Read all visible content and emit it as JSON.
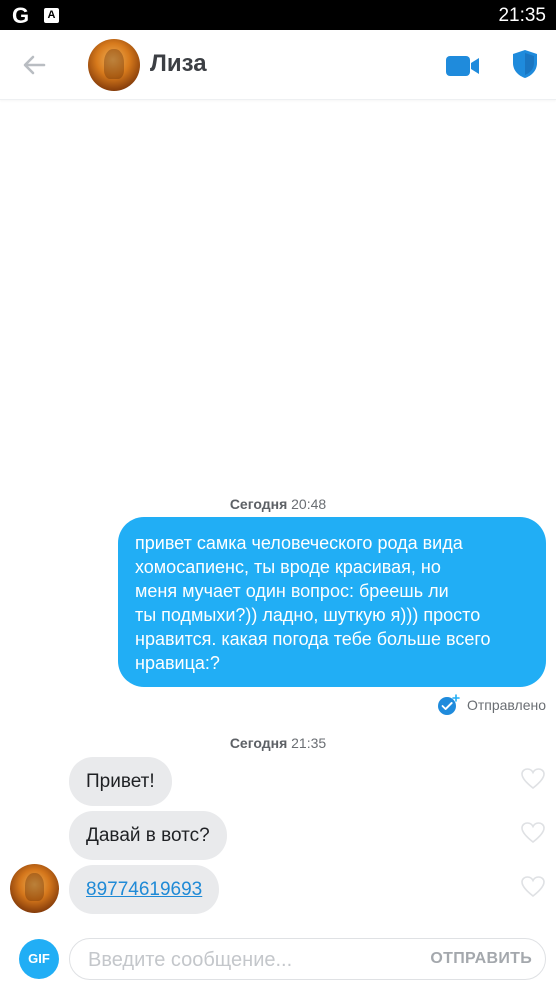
{
  "status_bar": {
    "time": "21:35",
    "icons": [
      "google-icon",
      "a-icon"
    ]
  },
  "header": {
    "contact_name": "Лиза",
    "icons": {
      "back": "arrow-left-icon",
      "video": "video-camera-icon",
      "safety": "shield-icon"
    },
    "accent_color": "#21aef5"
  },
  "messages": {
    "group1": {
      "date_label": "Сегодня",
      "time": "20:48",
      "outgoing_lines": [
        "привет самка человеческого рода вида",
        "хомосапиенс, ты вроде красивая, но",
        "меня мучает один вопрос: бреешь ли",
        "ты подмыхи?)) ладно, шуткую я))) просто",
        "нравится. какая погода тебе больше всего",
        "нравица:?"
      ],
      "status": "Отправлено"
    },
    "group2": {
      "date_label": "Сегодня",
      "time": "21:35",
      "incoming": [
        "Привет!",
        "Давай в вотс?",
        "89774619693"
      ]
    }
  },
  "composer": {
    "gif_label": "GIF",
    "placeholder": "Введите сообщение...",
    "send_label": "ОТПРАВИТЬ"
  }
}
